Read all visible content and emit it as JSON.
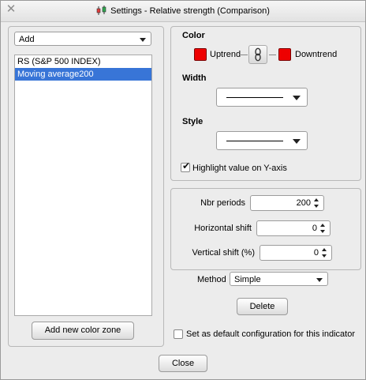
{
  "window": {
    "title": "Settings - Relative strength (Comparison)"
  },
  "left": {
    "add_select": "Add",
    "list_items": [
      "RS (S&P 500 INDEX)",
      "Moving average200"
    ],
    "selected_index": 1,
    "add_color_zone_label": "Add new color zone"
  },
  "style_panel": {
    "color_label": "Color",
    "uptrend_label": "Uptrend",
    "downtrend_label": "Downtrend",
    "uptrend_color": "#ee0000",
    "downtrend_color": "#ee0000",
    "width_label": "Width",
    "style_label": "Style",
    "highlight_label": "Highlight value on Y-axis",
    "highlight_checked": true
  },
  "params": {
    "nbr_periods_label": "Nbr periods",
    "nbr_periods_value": "200",
    "horizontal_shift_label": "Horizontal shift",
    "horizontal_shift_value": "0",
    "vertical_shift_label": "Vertical shift (%)",
    "vertical_shift_value": "0"
  },
  "method": {
    "label": "Method",
    "value": "Simple"
  },
  "delete_label": "Delete",
  "default_config_label": "Set as default configuration for this indicator",
  "default_config_checked": false,
  "close_label": "Close"
}
